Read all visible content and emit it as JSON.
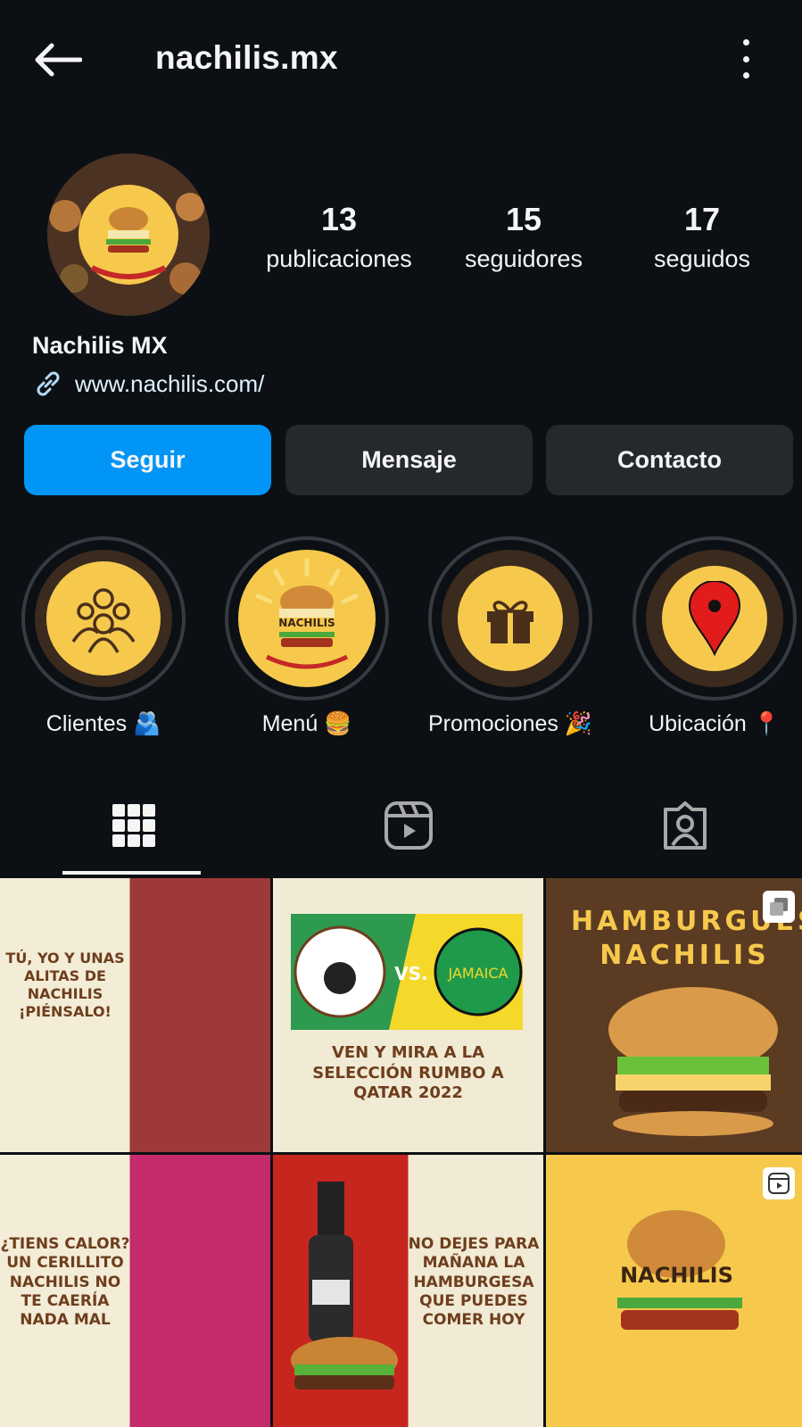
{
  "header": {
    "username": "nachilis.mx"
  },
  "profile": {
    "stats": [
      {
        "value": "13",
        "label": "publicaciones"
      },
      {
        "value": "15",
        "label": "seguidores"
      },
      {
        "value": "17",
        "label": "seguidos"
      }
    ],
    "display_name": "Nachilis MX",
    "website": "www.nachilis.com/"
  },
  "actions": {
    "follow_label": "Seguir",
    "message_label": "Mensaje",
    "contact_label": "Contacto"
  },
  "highlights": [
    {
      "label": "Clientes 🫂",
      "icon": "people-icon"
    },
    {
      "label": "Menú 🍔",
      "icon": "burger-logo-icon"
    },
    {
      "label": "Promociones 🎉",
      "icon": "gift-icon"
    },
    {
      "label": "Ubicación 📍",
      "icon": "map-pin-icon"
    }
  ],
  "tabs": [
    {
      "icon": "grid-icon",
      "active": true
    },
    {
      "icon": "reels-icon",
      "active": false
    },
    {
      "icon": "tagged-icon",
      "active": false
    }
  ],
  "posts": [
    {
      "text": "TÚ, YO Y UNAS ALITAS DE NACHILIS ¡PIÉNSALO!"
    },
    {
      "text": "VEN Y MIRA A LA SELECCIÓN RUMBO A QATAR 2022"
    },
    {
      "text": "HAMBURGUESA NACHILIS"
    },
    {
      "text": "¿TIENS CALOR? UN CERILLITO NACHILIS NO TE CAERÍA NADA MAL"
    },
    {
      "text": "NO DEJES PARA MAÑANA LA HAMBURGESA QUE PUEDES COMER HOY"
    },
    {
      "text": "NACHILIS"
    }
  ],
  "colors": {
    "background": "#0c1014",
    "primary_button": "#0095f6",
    "secondary_button": "#25292e",
    "brand_yellow": "#f6c94d"
  }
}
